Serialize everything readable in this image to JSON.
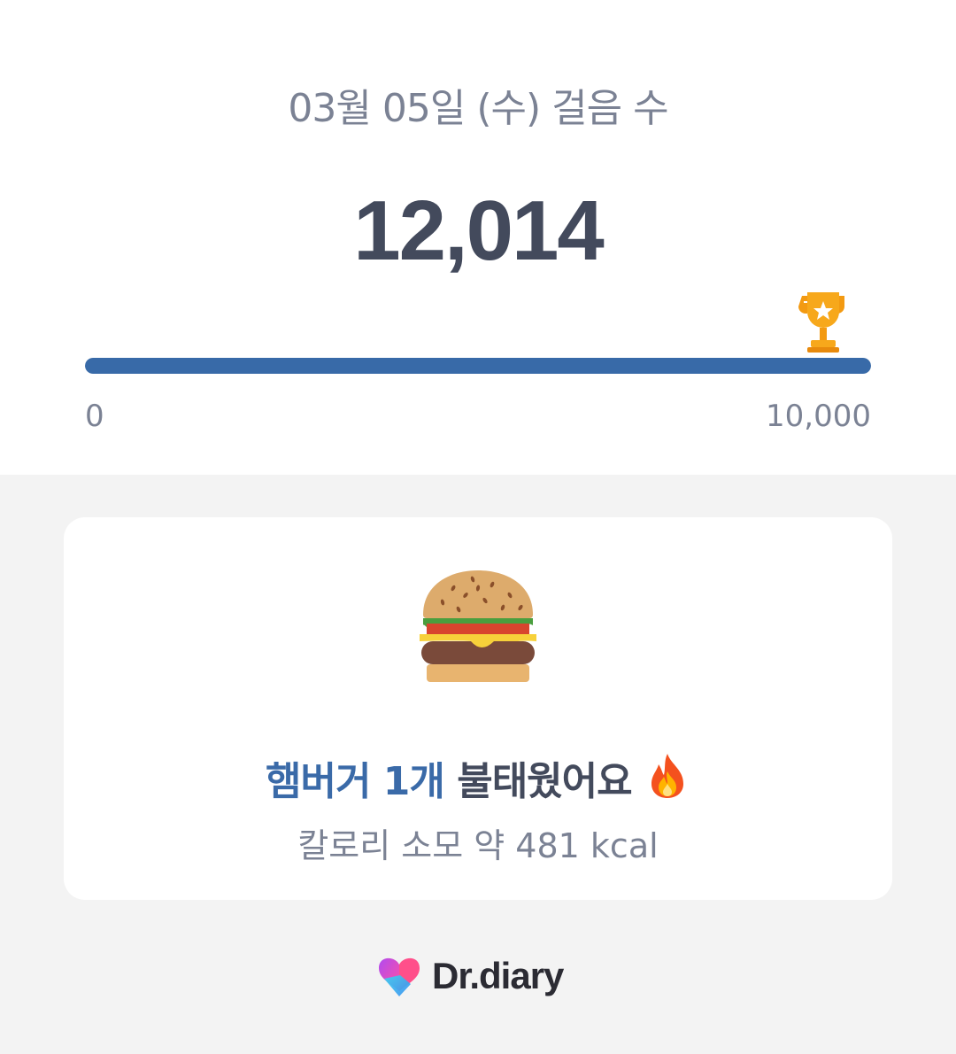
{
  "header": {
    "title": "03월 05일 (수) 걸음 수",
    "steps_display": "12,014"
  },
  "progress": {
    "min_label": "0",
    "max_label": "10,000",
    "value": 12014,
    "goal": 10000,
    "fill_fraction": 1.0,
    "goal_icon": "trophy-icon",
    "bar_color": "#386aa8"
  },
  "card": {
    "icon": "hamburger-icon",
    "food_text": "햄버거 1개",
    "action_text": "불태웠어요",
    "emoji_icon": "fire-icon",
    "calories_text": "칼로리 소모 약 481 kcal"
  },
  "footer": {
    "brand": "Dr.diary"
  }
}
